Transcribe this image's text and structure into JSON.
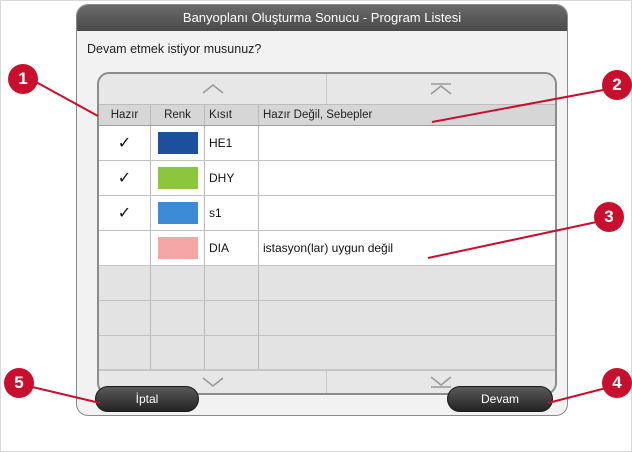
{
  "dialog": {
    "title": "Banyoplanı Oluşturma Sonucu - Program Listesi",
    "question": "Devam etmek istiyor musunuz?"
  },
  "table": {
    "headers": [
      "Hazır",
      "Renk",
      "Kısıt",
      "Hazır Değil, Sebepler"
    ],
    "rows": [
      {
        "ready": "✓",
        "color": "#1e4f9c",
        "name": "HE1",
        "reason": ""
      },
      {
        "ready": "✓",
        "color": "#8cc63e",
        "name": "DHY",
        "reason": ""
      },
      {
        "ready": "✓",
        "color": "#3d8bd4",
        "name": "s1",
        "reason": ""
      },
      {
        "ready": "",
        "color": "#f7a6a6",
        "name": "DIA",
        "reason": "istasyon(lar) uygun değil"
      }
    ],
    "scroll_icons": [
      "chevron-up-icon",
      "skip-to-top-icon",
      "chevron-down-icon",
      "skip-to-bottom-icon"
    ]
  },
  "buttons": {
    "cancel": "İptal",
    "continue": "Devam"
  },
  "markers": [
    "1",
    "2",
    "3",
    "4",
    "5"
  ],
  "colors": {
    "marker": "#c8102e",
    "title_bar": "#555555"
  }
}
